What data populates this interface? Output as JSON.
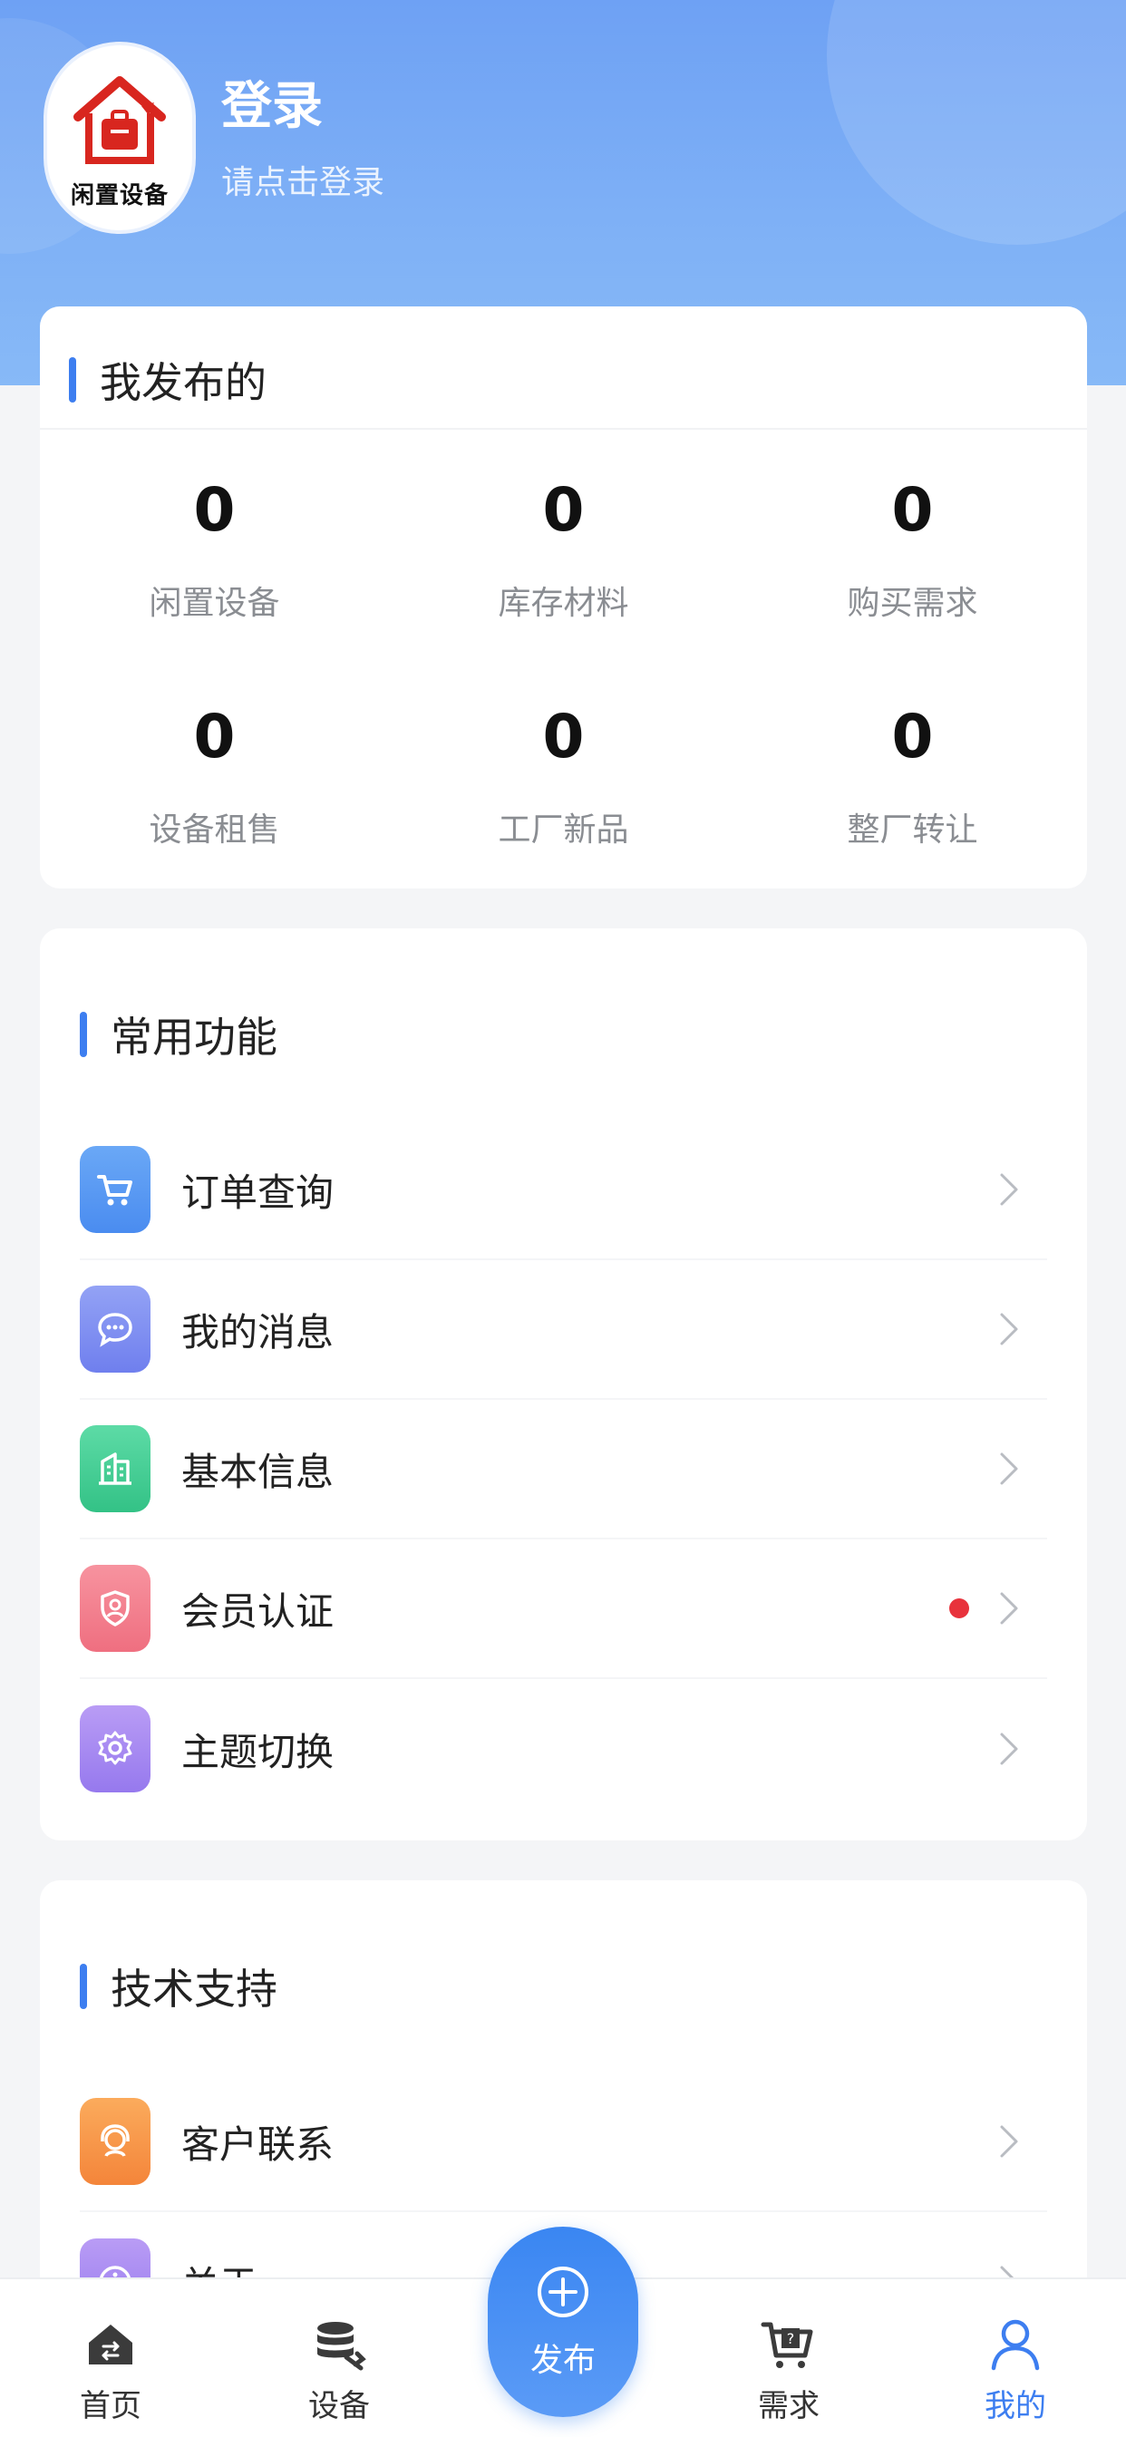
{
  "profile": {
    "logo_text": "闲置设备",
    "title": "登录",
    "subtitle": "请点击登录"
  },
  "published": {
    "title": "我发布的",
    "stats": [
      {
        "value": "0",
        "label": "闲置设备"
      },
      {
        "value": "0",
        "label": "库存材料"
      },
      {
        "value": "0",
        "label": "购买需求"
      },
      {
        "value": "0",
        "label": "设备租售"
      },
      {
        "value": "0",
        "label": "工厂新品"
      },
      {
        "value": "0",
        "label": "整厂转让"
      }
    ]
  },
  "common": {
    "title": "常用功能",
    "items": [
      {
        "label": "订单查询",
        "icon": "cart-icon",
        "color": "#5a9bf2"
      },
      {
        "label": "我的消息",
        "icon": "message-icon",
        "color": "#7f8ff0"
      },
      {
        "label": "基本信息",
        "icon": "building-icon",
        "color": "#3fcf93"
      },
      {
        "label": "会员认证",
        "icon": "badge-icon",
        "color": "#f27f8e",
        "dot": true
      },
      {
        "label": "主题切换",
        "icon": "gear-icon",
        "color": "#a88cf2"
      }
    ]
  },
  "support": {
    "title": "技术支持",
    "items": [
      {
        "label": "客户联系",
        "icon": "service-icon",
        "color": "#f7964a"
      },
      {
        "label": "关于",
        "icon": "info-icon",
        "color": "#a88cf2"
      }
    ]
  },
  "tabbar": {
    "items": [
      {
        "label": "首页",
        "icon": "home-icon"
      },
      {
        "label": "设备",
        "icon": "database-icon"
      },
      {
        "label": "需求",
        "icon": "cart-question-icon"
      },
      {
        "label": "我的",
        "icon": "user-icon",
        "active": true
      }
    ],
    "publish_label": "发布",
    "accent": "#3d7ef0"
  }
}
